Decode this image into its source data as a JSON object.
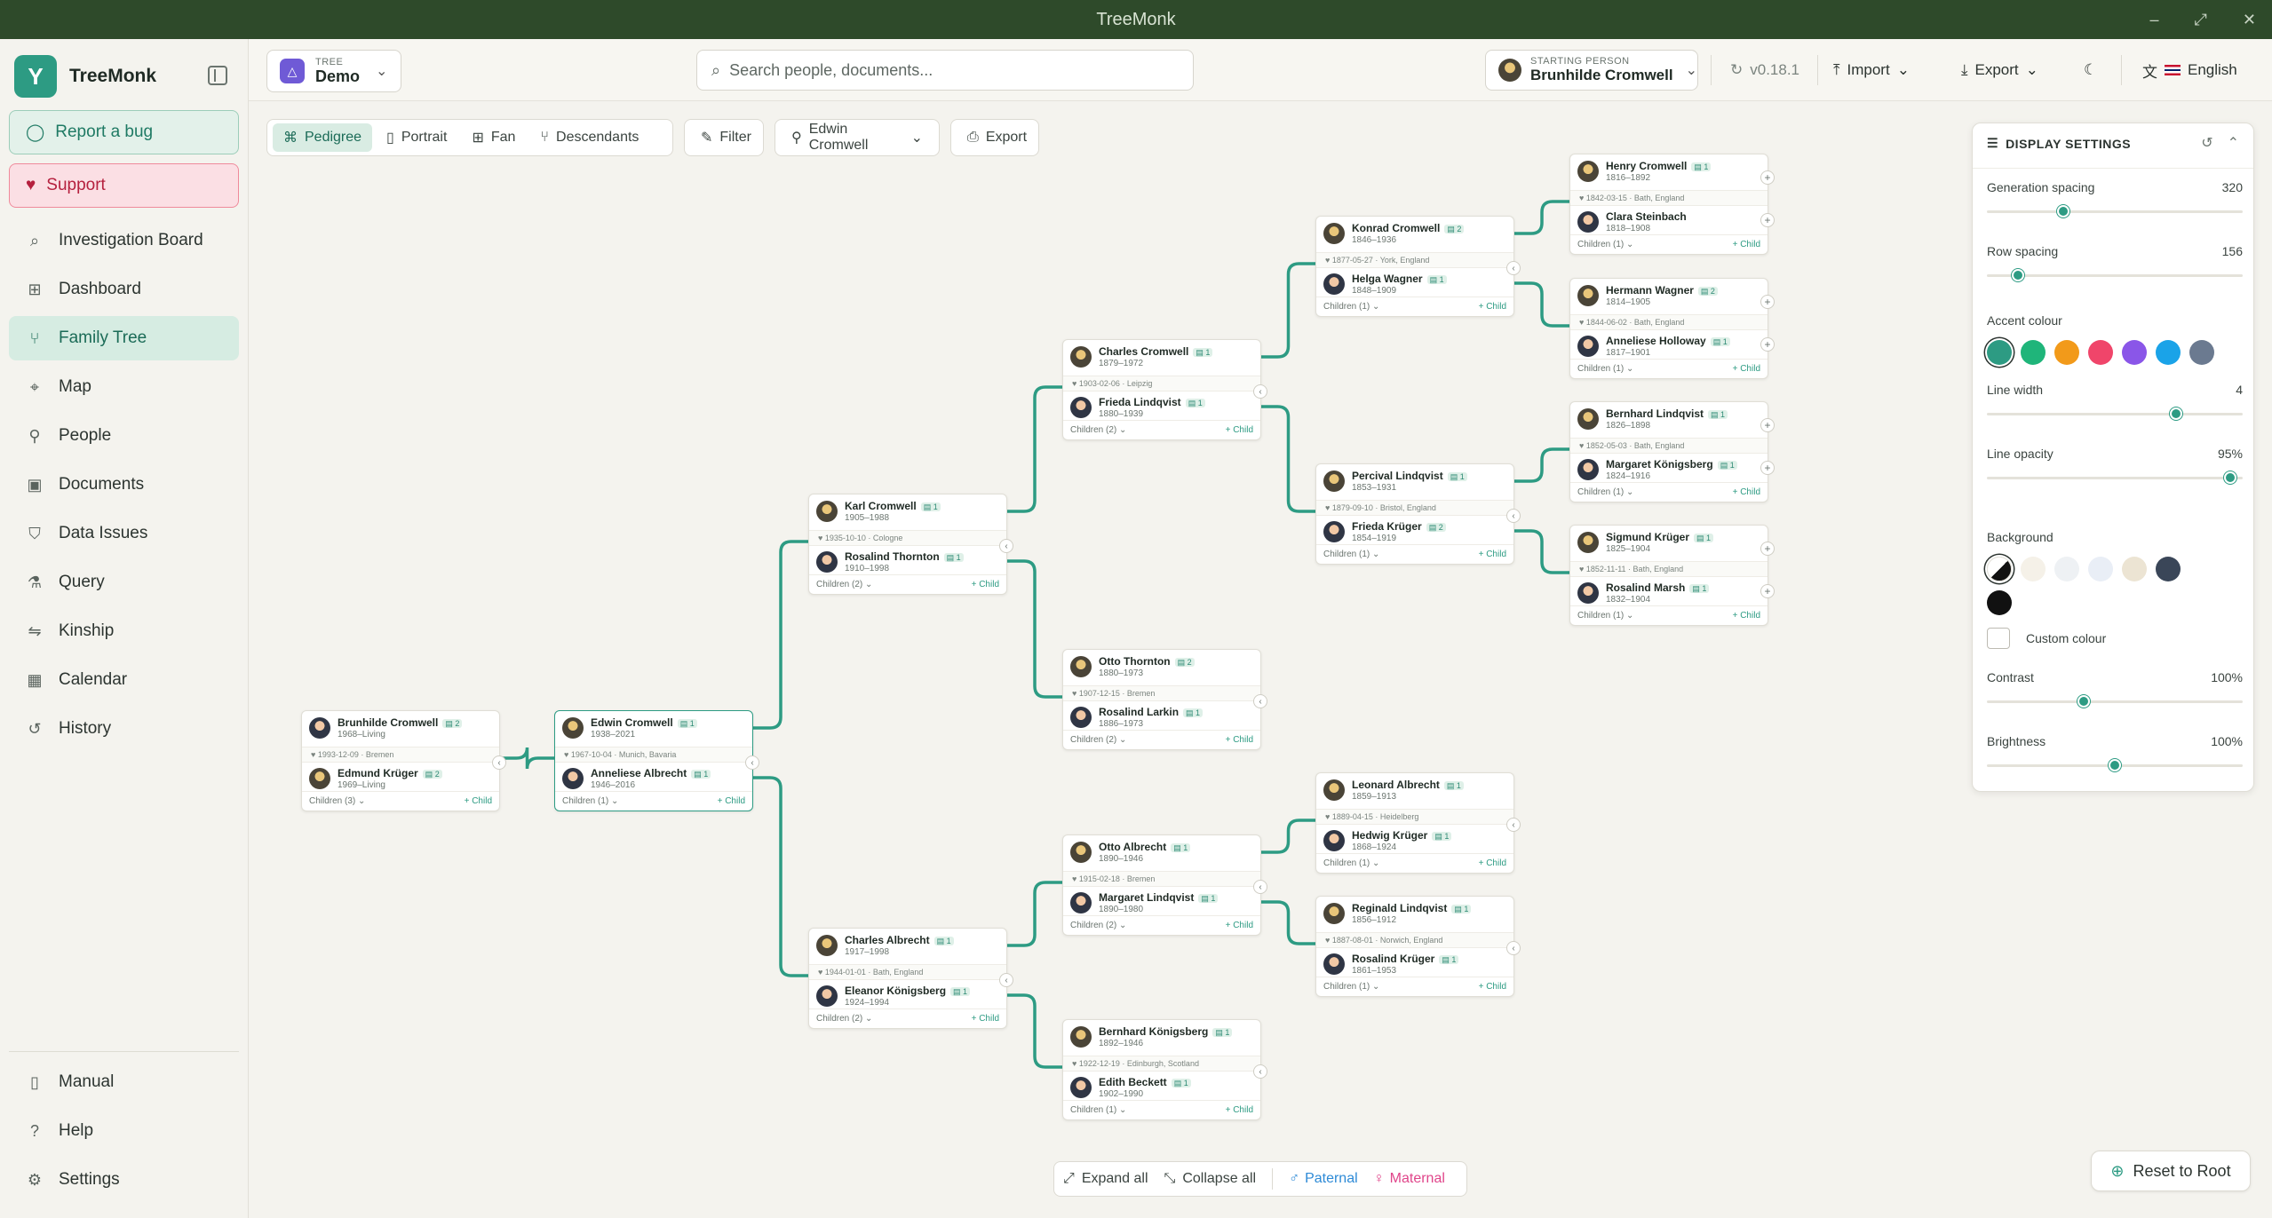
{
  "window": {
    "title": "TreeMonk"
  },
  "sidebar": {
    "brand": "TreeMonk",
    "report_bug": "Report a bug",
    "support": "Support",
    "items": [
      {
        "label": "Investigation Board",
        "icon": "search-icon"
      },
      {
        "label": "Dashboard",
        "icon": "grid-icon"
      },
      {
        "label": "Family Tree",
        "icon": "tree-icon",
        "active": true
      },
      {
        "label": "Map",
        "icon": "map-pin-icon"
      },
      {
        "label": "People",
        "icon": "person-icon"
      },
      {
        "label": "Documents",
        "icon": "image-icon"
      },
      {
        "label": "Data Issues",
        "icon": "shield-icon"
      },
      {
        "label": "Query",
        "icon": "filter-icon"
      },
      {
        "label": "Kinship",
        "icon": "kinship-icon"
      },
      {
        "label": "Calendar",
        "icon": "calendar-icon"
      },
      {
        "label": "History",
        "icon": "history-icon"
      }
    ],
    "bottom_items": [
      {
        "label": "Manual",
        "icon": "book-icon"
      },
      {
        "label": "Help",
        "icon": "help-icon"
      },
      {
        "label": "Settings",
        "icon": "gear-icon"
      }
    ]
  },
  "header": {
    "tree_small": "TREE",
    "tree_name": "Demo",
    "search_placeholder": "Search people, documents...",
    "start_small": "STARTING PERSON",
    "start_name": "Brunhilde Cromwell",
    "version": "v0.18.1",
    "import": "Import",
    "export": "Export",
    "language": "English"
  },
  "toolbar": {
    "views": [
      "Pedigree",
      "Portrait",
      "Fan",
      "Descendants"
    ],
    "active_view": "Pedigree",
    "filter": "Filter",
    "person": "Edwin Cromwell",
    "export": "Export"
  },
  "cards": [
    {
      "a": {
        "name": "Brunhilde Cromwell",
        "years": "1968–Living",
        "badge": "2",
        "f": true
      },
      "marriage": "1993-12-09 · Bremen",
      "b": {
        "name": "Edmund Krüger",
        "years": "1969–Living",
        "badge": "2"
      },
      "children": "Children (3)",
      "add": "+ Child"
    },
    {
      "a": {
        "name": "Edwin Cromwell",
        "years": "1938–2021",
        "badge": "1"
      },
      "marriage": "1967-10-04 · Munich, Bavaria",
      "b": {
        "name": "Anneliese Albrecht",
        "years": "1946–2016",
        "badge": "1",
        "f": true
      },
      "children": "Children (1)",
      "add": "+ Child"
    },
    {
      "a": {
        "name": "Karl Cromwell",
        "years": "1905–1988",
        "badge": "1"
      },
      "marriage": "1935-10-10 · Cologne",
      "b": {
        "name": "Rosalind Thornton",
        "years": "1910–1998",
        "badge": "1",
        "f": true
      },
      "children": "Children (2)",
      "add": "+ Child"
    },
    {
      "a": {
        "name": "Charles Albrecht",
        "years": "1917–1998",
        "badge": "1"
      },
      "marriage": "1944-01-01 · Bath, England",
      "b": {
        "name": "Eleanor Königsberg",
        "years": "1924–1994",
        "badge": "1",
        "f": true
      },
      "children": "Children (2)",
      "add": "+ Child"
    },
    {
      "a": {
        "name": "Charles Cromwell",
        "years": "1879–1972",
        "badge": "1"
      },
      "marriage": "1903-02-06 · Leipzig",
      "b": {
        "name": "Frieda Lindqvist",
        "years": "1880–1939",
        "badge": "1",
        "f": true
      },
      "children": "Children (2)",
      "add": "+ Child"
    },
    {
      "a": {
        "name": "Otto Thornton",
        "years": "1880–1973",
        "badge": "2"
      },
      "marriage": "1907-12-15 · Bremen",
      "b": {
        "name": "Rosalind Larkin",
        "years": "1886–1973",
        "badge": "1",
        "f": true
      },
      "children": "Children (2)",
      "add": "+ Child"
    },
    {
      "a": {
        "name": "Otto Albrecht",
        "years": "1890–1946",
        "badge": "1"
      },
      "marriage": "1915-02-18 · Bremen",
      "b": {
        "name": "Margaret Lindqvist",
        "years": "1890–1980",
        "badge": "1",
        "f": true
      },
      "children": "Children (2)",
      "add": "+ Child"
    },
    {
      "a": {
        "name": "Bernhard Königsberg",
        "years": "1892–1946",
        "badge": "1"
      },
      "marriage": "1922-12-19 · Edinburgh, Scotland",
      "b": {
        "name": "Edith Beckett",
        "years": "1902–1990",
        "badge": "1",
        "f": true
      },
      "children": "Children (1)",
      "add": "+ Child"
    },
    {
      "a": {
        "name": "Konrad Cromwell",
        "years": "1846–1936",
        "badge": "2"
      },
      "marriage": "1877-05-27 · York, England",
      "b": {
        "name": "Helga Wagner",
        "years": "1848–1909",
        "badge": "1",
        "f": true
      },
      "children": "Children (1)",
      "add": "+ Child"
    },
    {
      "a": {
        "name": "Percival Lindqvist",
        "years": "1853–1931",
        "badge": "1"
      },
      "marriage": "1879-09-10 · Bristol, England",
      "b": {
        "name": "Frieda Krüger",
        "years": "1854–1919",
        "badge": "2",
        "f": true
      },
      "children": "Children (1)",
      "add": "+ Child"
    },
    {
      "a": {
        "name": "Leonard Albrecht",
        "years": "1859–1913",
        "badge": "1"
      },
      "marriage": "1889-04-15 · Heidelberg",
      "b": {
        "name": "Hedwig Krüger",
        "years": "1868–1924",
        "badge": "1",
        "f": true
      },
      "children": "Children (1)",
      "add": "+ Child"
    },
    {
      "a": {
        "name": "Reginald Lindqvist",
        "years": "1856–1912",
        "badge": "1"
      },
      "marriage": "1887-08-01 · Norwich, England",
      "b": {
        "name": "Rosalind Krüger",
        "years": "1861–1953",
        "badge": "1",
        "f": true
      },
      "children": "Children (1)",
      "add": "+ Child"
    },
    {
      "a": {
        "name": "Henry Cromwell",
        "years": "1816–1892",
        "badge": "1"
      },
      "marriage": "1842-03-15 · Bath, England",
      "b": {
        "name": "Clara Steinbach",
        "years": "1818–1908",
        "badge": "",
        "f": true
      },
      "children": "Children (1)",
      "add": "+ Child"
    },
    {
      "a": {
        "name": "Hermann Wagner",
        "years": "1814–1905",
        "badge": "2"
      },
      "marriage": "1844-06-02 · Bath, England",
      "b": {
        "name": "Anneliese Holloway",
        "years": "1817–1901",
        "badge": "1",
        "f": true
      },
      "children": "Children (1)",
      "add": "+ Child"
    },
    {
      "a": {
        "name": "Bernhard Lindqvist",
        "years": "1826–1898",
        "badge": "1"
      },
      "marriage": "1852-05-03 · Bath, England",
      "b": {
        "name": "Margaret Königsberg",
        "years": "1824–1916",
        "badge": "1",
        "f": true
      },
      "children": "Children (1)",
      "add": "+ Child"
    },
    {
      "a": {
        "name": "Sigmund Krüger",
        "years": "1825–1904",
        "badge": "1"
      },
      "marriage": "1852-11-11 · Bath, England",
      "b": {
        "name": "Rosalind Marsh",
        "years": "1832–1904",
        "badge": "1",
        "f": true
      },
      "children": "Children (1)",
      "add": "+ Child"
    }
  ],
  "bottombar": {
    "expand": "Expand all",
    "collapse": "Collapse all",
    "paternal": "Paternal",
    "maternal": "Maternal",
    "paternal_color": "#2d8ad6",
    "maternal_color": "#e0458a"
  },
  "reset": "Reset to Root",
  "settings": {
    "title": "DISPLAY SETTINGS",
    "generation_spacing": {
      "label": "Generation spacing",
      "value": "320",
      "level": 0.3
    },
    "row_spacing": {
      "label": "Row spacing",
      "value": "156",
      "level": 0.12
    },
    "accent_label": "Accent colour",
    "accent_colors": [
      "#2d9b83",
      "#1fb57a",
      "#f29a1a",
      "#f0456a",
      "#8a56e8",
      "#1aa3e8",
      "#6b7a90"
    ],
    "line_width": {
      "label": "Line width",
      "value": "4",
      "level": 0.74
    },
    "line_opacity": {
      "label": "Line opacity",
      "value": "95%",
      "level": 0.95
    },
    "background_label": "Background",
    "background_colors": [
      "#ffffff",
      "#f5f1e8",
      "#eef1f4",
      "#e9eef6",
      "#ece4d3",
      "#3a4658",
      "#111111"
    ],
    "custom_colour": "Custom colour",
    "contrast": {
      "label": "Contrast",
      "value": "100%",
      "level": 0.38
    },
    "brightness": {
      "label": "Brightness",
      "value": "100%",
      "level": 0.5
    }
  },
  "colors": {
    "accent": "#2d9b83",
    "titlebar": "#2e4a2a"
  }
}
